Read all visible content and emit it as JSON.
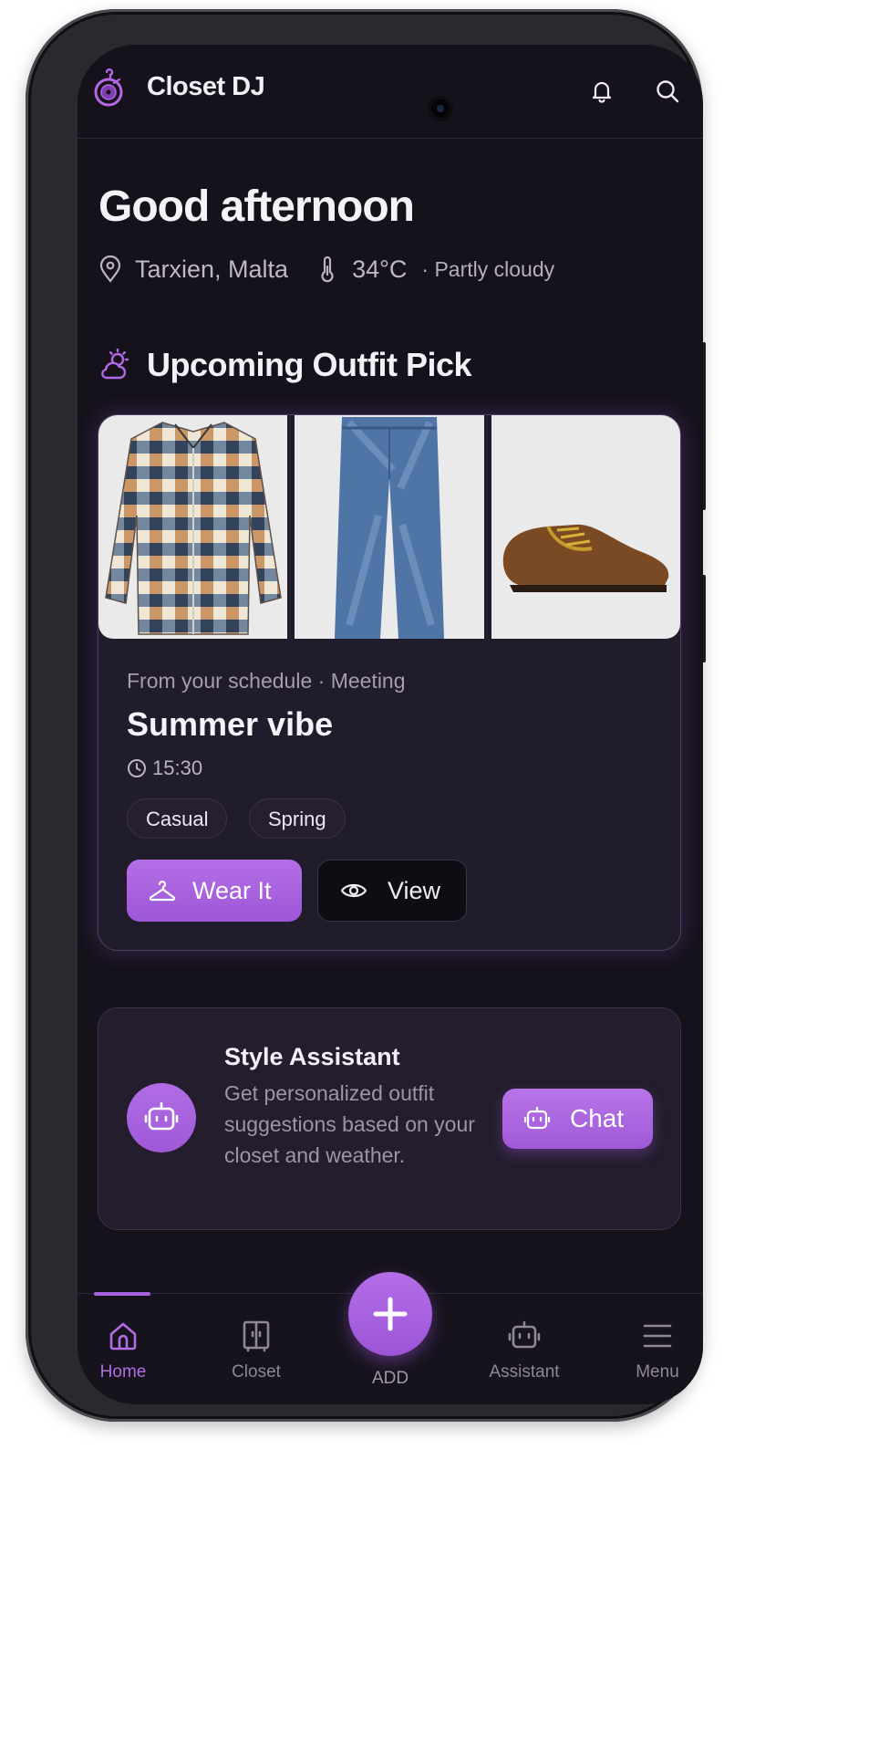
{
  "app": {
    "title": "Closet DJ"
  },
  "greeting": "Good afternoon",
  "weather": {
    "location": "Tarxien, Malta",
    "temperature": "34°C",
    "condition": "· Partly cloudy"
  },
  "upcoming": {
    "section_title": "Upcoming Outfit Pick",
    "subtitle": "From your schedule · Meeting",
    "title": "Summer vibe",
    "time": "15:30",
    "tags": [
      "Casual",
      "Spring"
    ],
    "wear_label": "Wear It",
    "view_label": "View",
    "items": [
      "plaid shirt",
      "jeans",
      "brown suede shoe"
    ]
  },
  "assistant_card": {
    "title": "Style Assistant",
    "description": "Get personalized outfit suggestions based on your closet and weather.",
    "chat_label": "Chat"
  },
  "nav": {
    "home": "Home",
    "closet": "Closet",
    "add": "ADD",
    "assistant": "Assistant",
    "menu": "Menu",
    "active": "home"
  },
  "colors": {
    "accent": "#a763df",
    "background": "#15121b",
    "card": "#211c2b"
  },
  "icons": [
    "vinyl-hanger-logo-icon",
    "bell-icon",
    "search-icon",
    "location-pin-icon",
    "thermometer-icon",
    "sun-cloud-icon",
    "clock-icon",
    "hanger-icon",
    "eye-icon",
    "robot-icon",
    "home-icon",
    "closet-icon",
    "plus-icon",
    "menu-icon"
  ]
}
